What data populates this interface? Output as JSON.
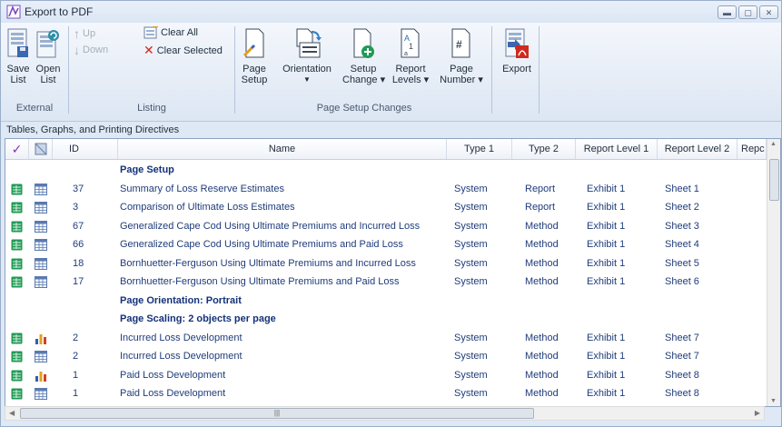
{
  "window": {
    "title": "Export to PDF"
  },
  "ribbon": {
    "external": {
      "label": "External",
      "save": "Save\nList",
      "open": "Open\nList"
    },
    "listing": {
      "label": "Listing",
      "up": "Up",
      "down": "Down",
      "clear_all": "Clear All",
      "clear_selected": "Clear Selected"
    },
    "page_setup_changes": {
      "label": "Page Setup Changes",
      "page_setup": "Page\nSetup",
      "orientation": "Orientation",
      "setup_change": "Setup\nChange ▾",
      "report_levels": "Report\nLevels ▾",
      "page_number": "Page\nNumber ▾"
    },
    "export": {
      "label": "Export"
    }
  },
  "section_label": "Tables, Graphs, and Printing Directives",
  "grid": {
    "columns": {
      "id": "ID",
      "name": "Name",
      "type1": "Type 1",
      "type2": "Type 2",
      "rl1": "Report Level 1",
      "rl2": "Report Level 2",
      "rl3": "Repc"
    },
    "rows": [
      {
        "kind": "group",
        "name": "Page Setup"
      },
      {
        "kind": "item",
        "icon": "table",
        "id": "37",
        "name": "Summary of Loss Reserve Estimates",
        "type1": "System",
        "type2": "Report",
        "rl1": "Exhibit 1",
        "rl2": "Sheet 1"
      },
      {
        "kind": "item",
        "icon": "table",
        "id": "3",
        "name": "Comparison of Ultimate Loss Estimates",
        "type1": "System",
        "type2": "Report",
        "rl1": "Exhibit 1",
        "rl2": "Sheet 2"
      },
      {
        "kind": "item",
        "icon": "table",
        "id": "67",
        "name": "Generalized Cape Cod Using Ultimate Premiums and Incurred Loss",
        "type1": "System",
        "type2": "Method",
        "rl1": "Exhibit 1",
        "rl2": "Sheet 3"
      },
      {
        "kind": "item",
        "icon": "table",
        "id": "66",
        "name": "Generalized Cape Cod Using Ultimate Premiums and Paid Loss",
        "type1": "System",
        "type2": "Method",
        "rl1": "Exhibit 1",
        "rl2": "Sheet 4"
      },
      {
        "kind": "item",
        "icon": "table",
        "id": "18",
        "name": "Bornhuetter-Ferguson Using Ultimate Premiums and Incurred Loss",
        "type1": "System",
        "type2": "Method",
        "rl1": "Exhibit 1",
        "rl2": "Sheet 5"
      },
      {
        "kind": "item",
        "icon": "table",
        "id": "17",
        "name": "Bornhuetter-Ferguson Using Ultimate Premiums and Paid Loss",
        "type1": "System",
        "type2": "Method",
        "rl1": "Exhibit 1",
        "rl2": "Sheet 6"
      },
      {
        "kind": "group",
        "name": "Page Orientation: Portrait"
      },
      {
        "kind": "group",
        "name": "Page Scaling: 2 objects per page"
      },
      {
        "kind": "item",
        "icon": "chart",
        "id": "2",
        "name": "Incurred Loss Development",
        "type1": "System",
        "type2": "Method",
        "rl1": "Exhibit 1",
        "rl2": "Sheet 7"
      },
      {
        "kind": "item",
        "icon": "table",
        "id": "2",
        "name": "Incurred Loss Development",
        "type1": "System",
        "type2": "Method",
        "rl1": "Exhibit 1",
        "rl2": "Sheet 7"
      },
      {
        "kind": "item",
        "icon": "chart",
        "id": "1",
        "name": "Paid Loss Development",
        "type1": "System",
        "type2": "Method",
        "rl1": "Exhibit 1",
        "rl2": "Sheet 8"
      },
      {
        "kind": "item",
        "icon": "table",
        "id": "1",
        "name": "Paid Loss Development",
        "type1": "System",
        "type2": "Method",
        "rl1": "Exhibit 1",
        "rl2": "Sheet 8"
      }
    ]
  },
  "colors": {
    "accent_check": "#8b2fb8",
    "row_text": "#1f3c7a",
    "group_text": "#14327a",
    "select_icon": "#1f9a55"
  },
  "icons": [
    "app-icon",
    "minimize-icon",
    "maximize-icon",
    "close-icon",
    "save-list-icon",
    "open-list-icon",
    "up-arrow-icon",
    "down-arrow-icon",
    "clear-all-icon",
    "clear-selected-icon",
    "page-setup-icon",
    "orientation-icon",
    "setup-change-icon",
    "report-levels-icon",
    "page-number-icon",
    "export-pdf-icon",
    "checkmark-icon",
    "table-icon",
    "chart-icon"
  ]
}
